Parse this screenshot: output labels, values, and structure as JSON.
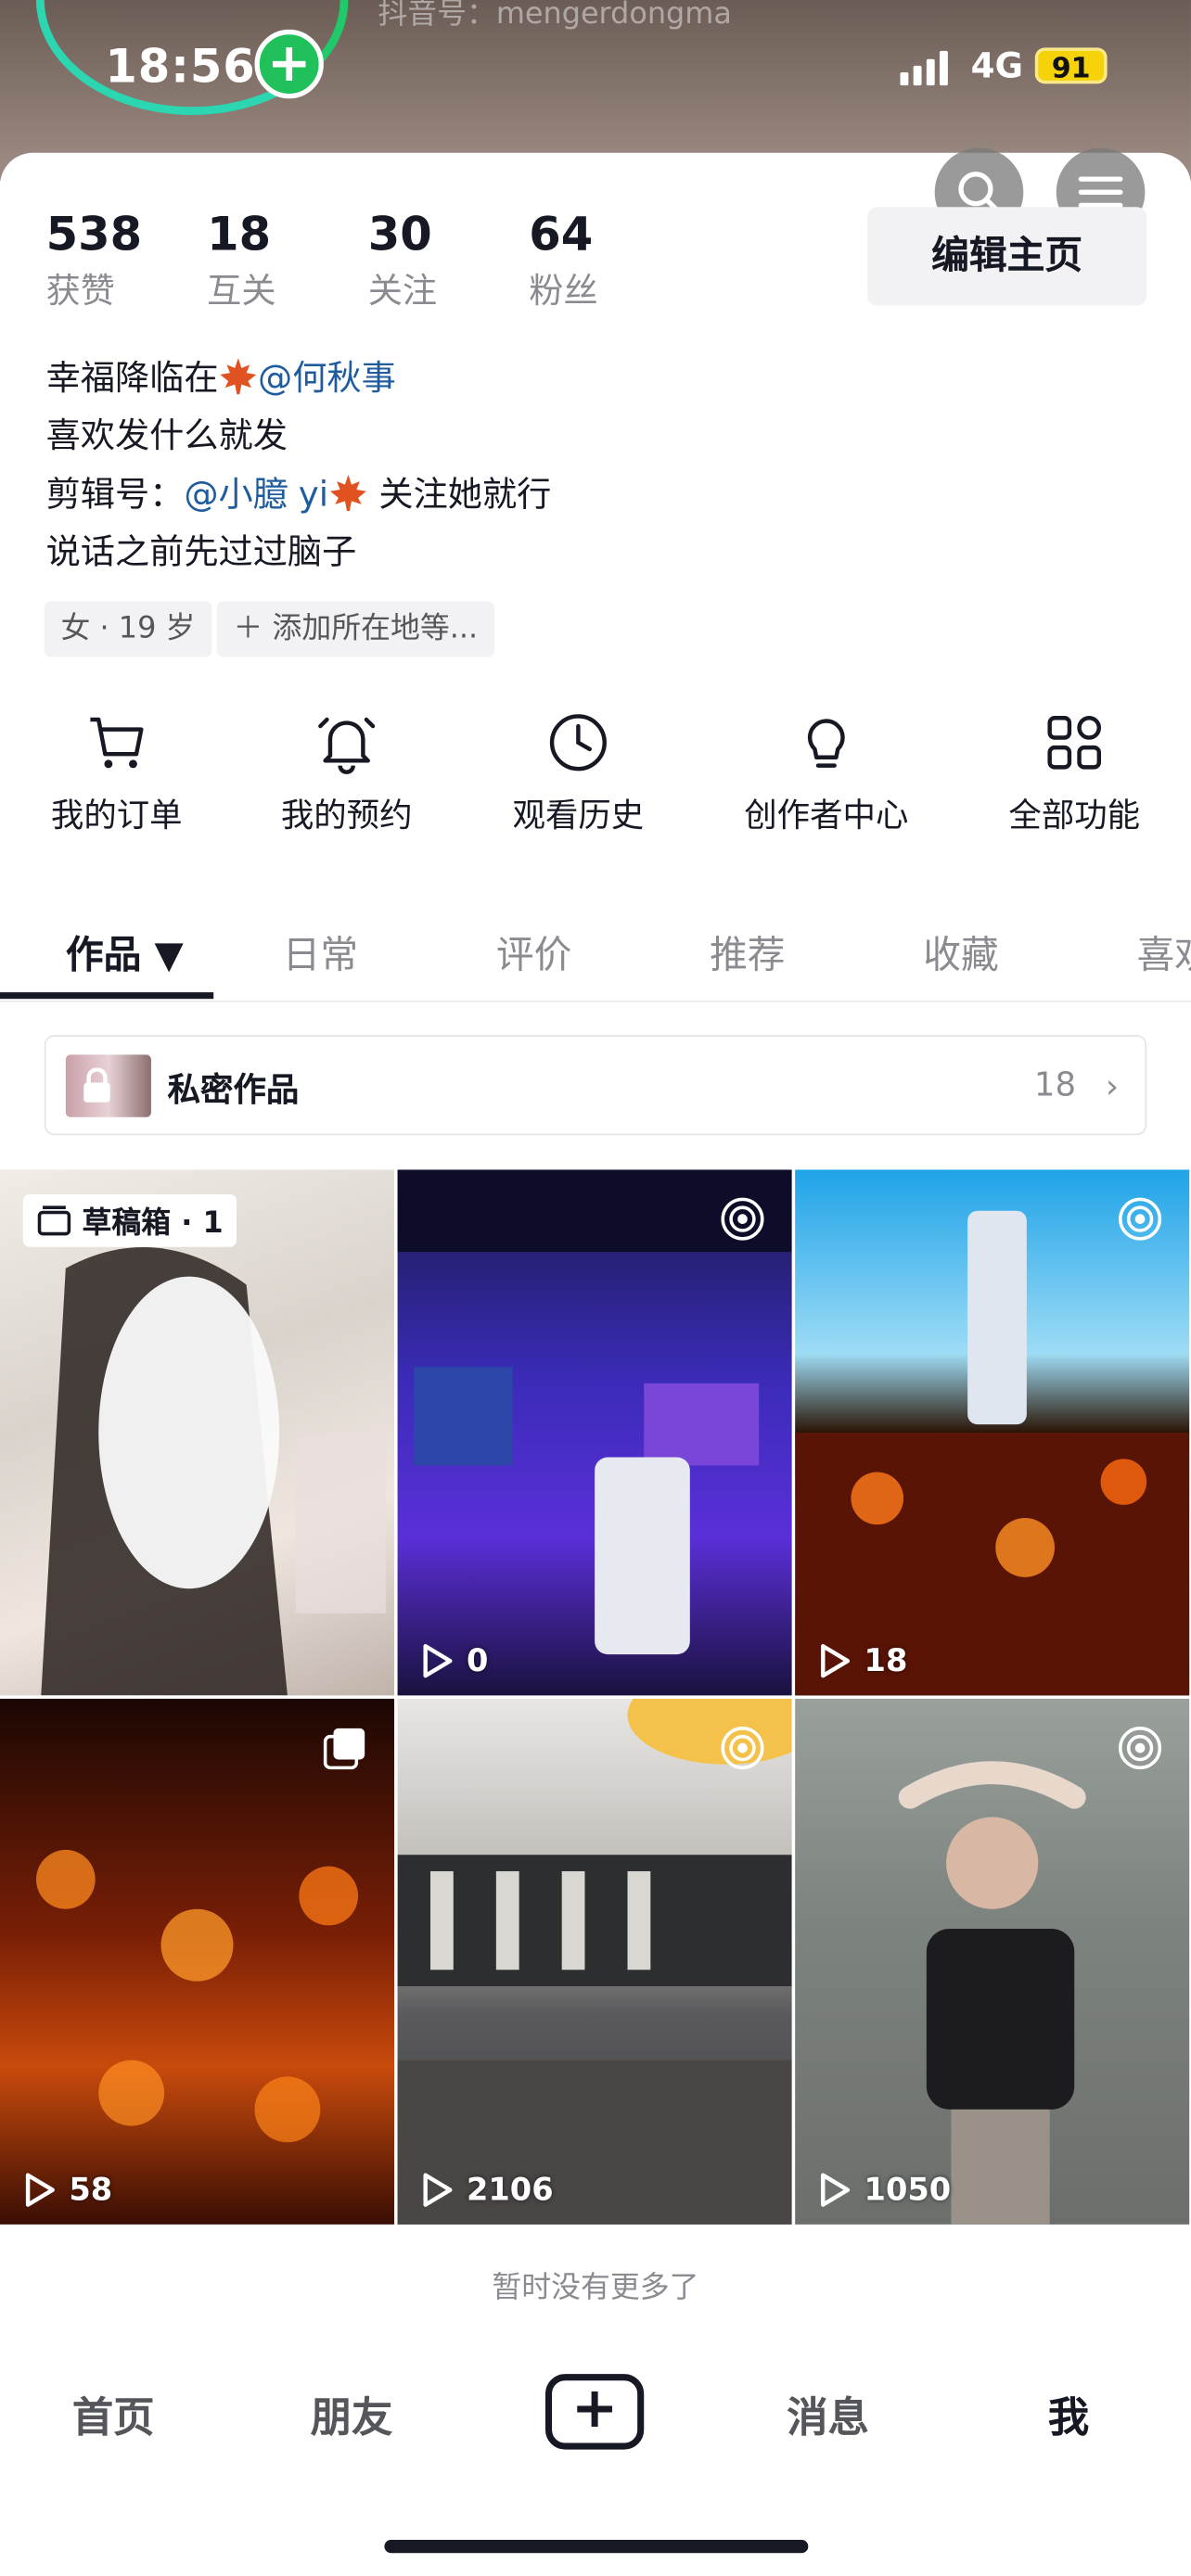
{
  "status_bar": {
    "time": "18:56",
    "network": "4G",
    "battery": "91"
  },
  "profile": {
    "handle_partial": "抖音号：mengerdongma",
    "edit_label": "编辑主页",
    "stats": [
      {
        "value": "538",
        "label": "获赞"
      },
      {
        "value": "18",
        "label": "互关"
      },
      {
        "value": "30",
        "label": "关注"
      },
      {
        "value": "64",
        "label": "粉丝"
      }
    ],
    "bio": {
      "line1_text": "幸福降临在",
      "line1_mention": "@何秋事",
      "line2": "喜欢发什么就发",
      "line3_prefix": "剪辑号：",
      "line3_mention": "@小臆 yi",
      "line3_suffix": " 关注她就行",
      "line4": "说话之前先过过脑子"
    },
    "tags": [
      "女 · 19 岁",
      "＋ 添加所在地等..."
    ]
  },
  "functions": [
    {
      "label": "我的订单",
      "icon": "cart-icon"
    },
    {
      "label": "我的预约",
      "icon": "bell-icon"
    },
    {
      "label": "观看历史",
      "icon": "clock-icon"
    },
    {
      "label": "创作者中心",
      "icon": "bulb-icon"
    },
    {
      "label": "全部功能",
      "icon": "grid-icon"
    }
  ],
  "tabs": [
    "作品 ▼",
    "日常",
    "评价",
    "推荐",
    "收藏",
    "喜欢"
  ],
  "private_works": {
    "label": "私密作品",
    "count": "18"
  },
  "grid": {
    "draft_label": "草稿箱 · 1",
    "items": [
      {
        "plays": "0"
      },
      {
        "plays": "18"
      },
      {
        "plays": "58"
      },
      {
        "plays": "2106"
      },
      {
        "plays": "1050"
      }
    ]
  },
  "no_more": "暂时没有更多了",
  "nav": {
    "home": "首页",
    "friends": "朋友",
    "messages": "消息",
    "me": "我"
  },
  "colors": {
    "mention": "#1f5c9e",
    "accent_green": "#20c15a",
    "battery": "#f5d20a"
  }
}
